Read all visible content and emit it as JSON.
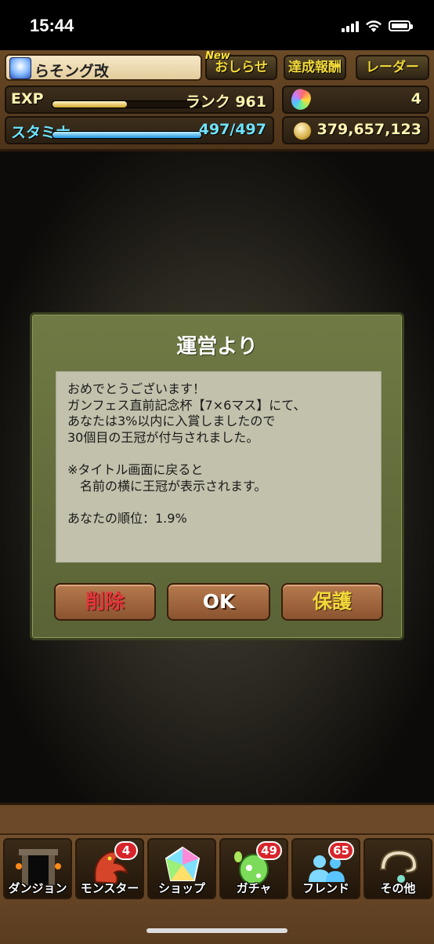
{
  "status_bar": {
    "time": "15:44"
  },
  "header": {
    "player_name": "らそング改",
    "news_badge": "New",
    "news_label": "おしらせ",
    "reports_label": "達成報酬",
    "radar_label": "レーダー",
    "exp_label": "EXP",
    "exp_fill_fraction": 0.5,
    "rank_text": "ランク 961",
    "stamina_label": "スタミナ",
    "stamina_fill_fraction": 1.0,
    "stamina_value": "497/497",
    "magic_stones": "4",
    "coins": "379,657,123"
  },
  "dialog": {
    "title": "運営より",
    "message_lines": [
      "おめでとうございます！",
      "ガンフェス直前記念杯【7×6マス】にて、",
      "あなたは3%以内に入賞しましたので",
      "30個目の王冠が付与されました。",
      "",
      "※タイトル画面に戻ると",
      "　名前の横に王冠が表示されます。",
      "",
      "あなたの順位：1.9%"
    ],
    "delete_label": "削除",
    "ok_label": "OK",
    "protect_label": "保護"
  },
  "nav": {
    "items": [
      {
        "label": "ダンジョン",
        "badge": "",
        "icon": "dungeon-gate-icon"
      },
      {
        "label": "モンスター",
        "badge": "4",
        "icon": "dragon-icon"
      },
      {
        "label": "ショップ",
        "badge": "",
        "icon": "magic-stone-icon"
      },
      {
        "label": "ガチャ",
        "badge": "49",
        "icon": "egg-icon"
      },
      {
        "label": "フレンド",
        "badge": "65",
        "icon": "friends-icon"
      },
      {
        "label": "その他",
        "badge": "",
        "icon": "question-icon"
      }
    ]
  }
}
